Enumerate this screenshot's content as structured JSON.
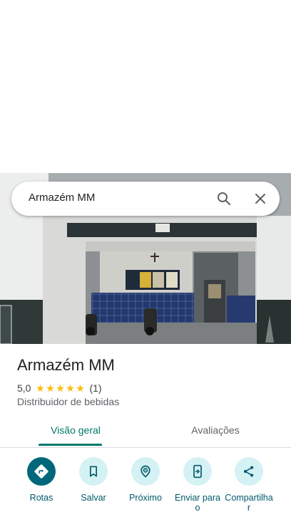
{
  "search": {
    "query": "Armazém MM"
  },
  "place": {
    "name": "Armazém MM",
    "rating": "5,0",
    "stars": [
      "★",
      "★",
      "★",
      "★",
      "★"
    ],
    "review_count": "(1)",
    "category": "Distribuidor de bebidas"
  },
  "tabs": [
    {
      "label": "Visão geral",
      "selected": true
    },
    {
      "label": "Avaliações",
      "selected": false
    }
  ],
  "actions": [
    {
      "label": "Rotas",
      "icon": "directions-icon"
    },
    {
      "label": "Salvar",
      "icon": "bookmark-icon"
    },
    {
      "label": "Próximo",
      "icon": "nearby-icon"
    },
    {
      "label": "Enviar para o",
      "icon": "send-to-phone-icon"
    },
    {
      "label": "Compartilha r",
      "icon": "share-icon"
    }
  ],
  "colors": {
    "accent": "#00796b",
    "action_primary": "#00677a",
    "action_secondary_bg": "#d4f1f4",
    "star": "#fbbc04"
  }
}
